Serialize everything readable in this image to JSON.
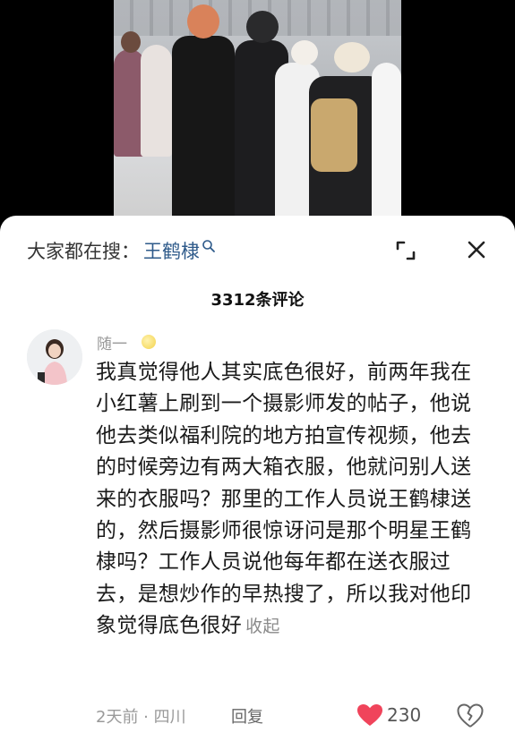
{
  "search": {
    "prefix": "大家都在搜：",
    "term": "王鹤棣"
  },
  "header": {
    "comment_count": "3312条评论"
  },
  "comment": {
    "username": "随一",
    "text": "我真觉得他人其实底色很好，前两年我在小红薯上刷到一个摄影师发的帖子，他说他去类似福利院的地方拍宣传视频，他去的时候旁边有两大箱衣服，他就问别人送来的衣服吗？那里的工作人员说王鹤棣送的，然后摄影师很惊讶问是那个明星王鹤棣吗？工作人员说他每年都在送衣服过去，是想炒作的早热搜了，所以我对他印象觉得底色很好",
    "collapse_label": "收起",
    "meta": "2天前 · 四川",
    "reply_label": "回复",
    "like_count": "230"
  },
  "colors": {
    "search_term": "#2e5a8a",
    "like_heart": "#f0445b",
    "sheet_bg": "#ffffff"
  },
  "icons": {
    "search": "search-icon",
    "expand": "expand-icon",
    "close": "close-icon",
    "like": "heart-filled-icon",
    "dislike": "broken-heart-icon"
  }
}
